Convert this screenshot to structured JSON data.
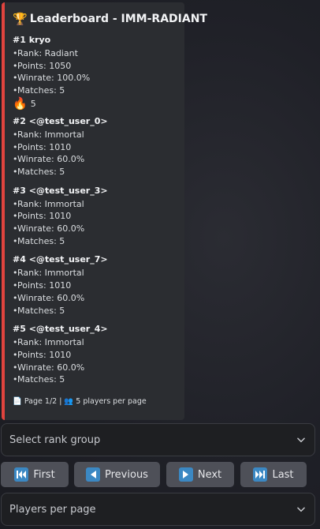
{
  "embed": {
    "trophy_icon": "trophy-icon",
    "title": "Leaderboard - IMM-RADIANT",
    "accent_color": "#e0443e",
    "players": [
      {
        "name": "#1 kryo",
        "rank": "Rank: Radiant",
        "points": "Points: 1050",
        "winrate": "Winrate: 100.0%",
        "matches": "Matches: 5",
        "streak": "5"
      },
      {
        "name": "#2 <@test_user_0>",
        "rank": "Rank: Immortal",
        "points": "Points: 1010",
        "winrate": "Winrate: 60.0%",
        "matches": "Matches: 5"
      },
      {
        "name": "#3 <@test_user_3>",
        "rank": "Rank: Immortal",
        "points": "Points: 1010",
        "winrate": "Winrate: 60.0%",
        "matches": "Matches: 5"
      },
      {
        "name": "#4 <@test_user_7>",
        "rank": "Rank: Immortal",
        "points": "Points: 1010",
        "winrate": "Winrate: 60.0%",
        "matches": "Matches: 5"
      },
      {
        "name": "#5 <@test_user_4>",
        "rank": "Rank: Immortal",
        "points": "Points: 1010",
        "winrate": "Winrate: 60.0%",
        "matches": "Matches: 5"
      }
    ],
    "footer": "Page 1/2 | 👥 5 players per page"
  },
  "controls": {
    "rank_select_placeholder": "Select rank group",
    "buttons": {
      "first": "First",
      "previous": "Previous",
      "next": "Next",
      "last": "Last"
    },
    "players_per_page_placeholder": "Players per page"
  },
  "colors": {
    "button_bg": "#4e5058",
    "icon_blue": "#3b88c3",
    "select_bg": "#1e1f22"
  }
}
